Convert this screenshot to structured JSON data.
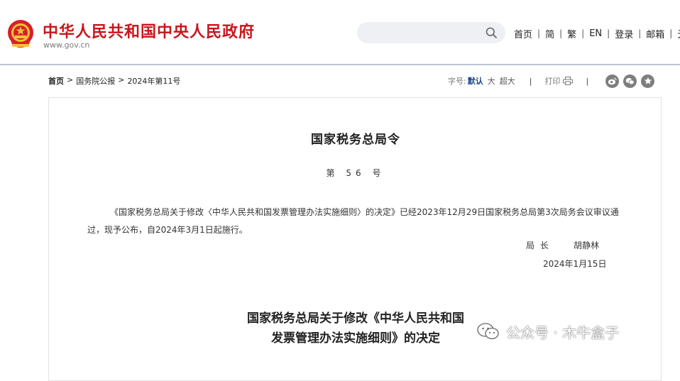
{
  "header": {
    "site_title": "中华人民共和国中央人民政府",
    "site_url": "www.gov.cn",
    "search": {
      "placeholder": ""
    },
    "nav": [
      "首页",
      "简",
      "繁",
      "EN",
      "登录",
      "邮箱",
      "无"
    ]
  },
  "breadcrumb": {
    "home": "首页",
    "items": [
      "国务院公报",
      "2024年第11号"
    ],
    "separator": ">"
  },
  "tools": {
    "font_size_label": "字号:",
    "font_default": "默认",
    "font_large": "大",
    "font_xlarge": "超大",
    "print": "打印",
    "share_icons": [
      "weibo-icon",
      "wechat-icon",
      "favorite-icon"
    ]
  },
  "document": {
    "title": "国家税务总局令",
    "number": "第 56 号",
    "body": "《国家税务总局关于修改〈中华人民共和国发票管理办法实施细则〉的决定》已经2023年12月29日国家税务总局第3次局务会议审议通过，现予公布，自2024年3月1日起施行。",
    "sign_role": "局 长",
    "sign_name": "胡静林",
    "sign_date": "2024年1月15日",
    "subtitle_line1": "国家税务总局关于修改《中华人民共和国",
    "subtitle_line2": "发票管理办法实施细则》的决定"
  },
  "watermark": {
    "text": "公众号 · 木牛盒子"
  },
  "colors": {
    "brand_red": "#c8161d",
    "link_blue": "#1a4a8a",
    "header_rule": "#b9c3d3"
  }
}
